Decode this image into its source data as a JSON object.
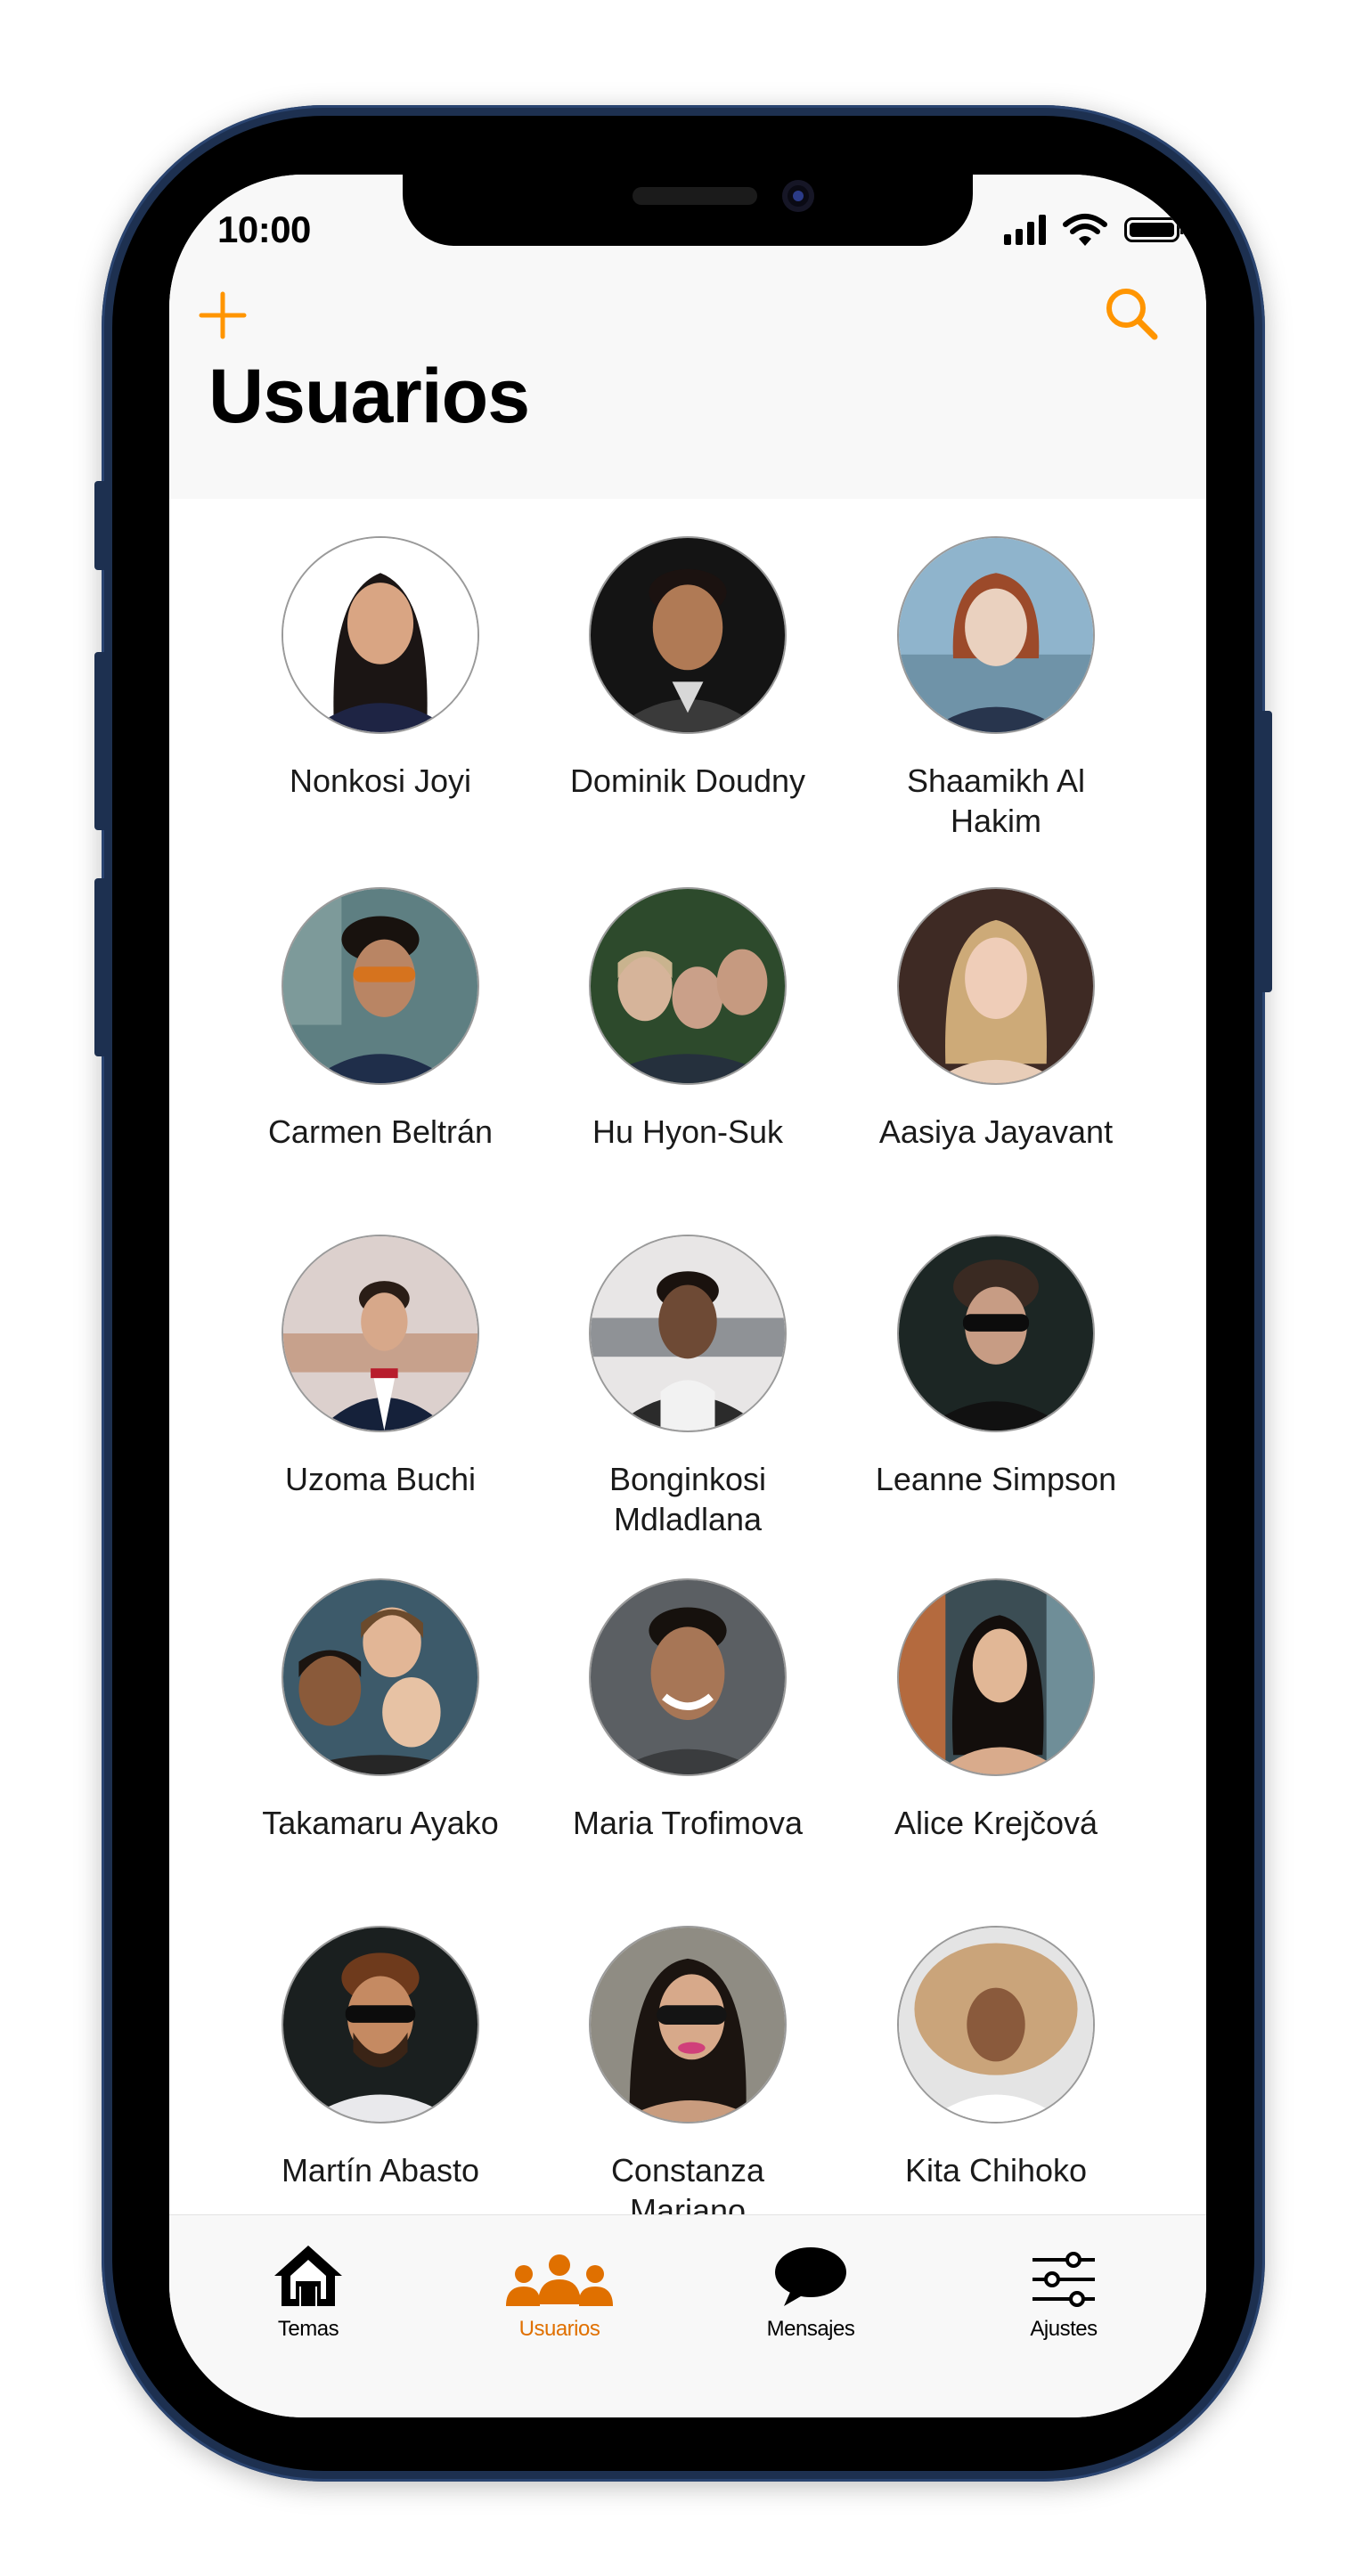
{
  "status_bar": {
    "time": "10:00"
  },
  "header": {
    "title": "Usuarios"
  },
  "accent_color": "#ff9500",
  "icons": {
    "add": "plus-icon",
    "search": "search-icon"
  },
  "users": [
    {
      "name": "Nonkosi Joyi"
    },
    {
      "name": "Dominik Doudny"
    },
    {
      "name": "Shaamikh Al Hakim"
    },
    {
      "name": "Carmen Beltrán"
    },
    {
      "name": "Hu Hyon-Suk"
    },
    {
      "name": "Aasiya Jayavant"
    },
    {
      "name": "Uzoma Buchi"
    },
    {
      "name": "Bonginkosi Mdladlana"
    },
    {
      "name": "Leanne Simpson"
    },
    {
      "name": "Takamaru Ayako"
    },
    {
      "name": "Maria Trofimova"
    },
    {
      "name": "Alice Krejčová"
    },
    {
      "name": "Martín Abasto"
    },
    {
      "name": "Constanza Mariano"
    },
    {
      "name": "Kita Chihoko"
    }
  ],
  "tabbar": {
    "tabs": [
      {
        "label": "Temas",
        "icon": "house-icon"
      },
      {
        "label": "Usuarios",
        "icon": "people-icon",
        "active": true
      },
      {
        "label": "Mensajes",
        "icon": "speech-bubble-icon"
      },
      {
        "label": "Ajustes",
        "icon": "sliders-icon"
      }
    ]
  }
}
